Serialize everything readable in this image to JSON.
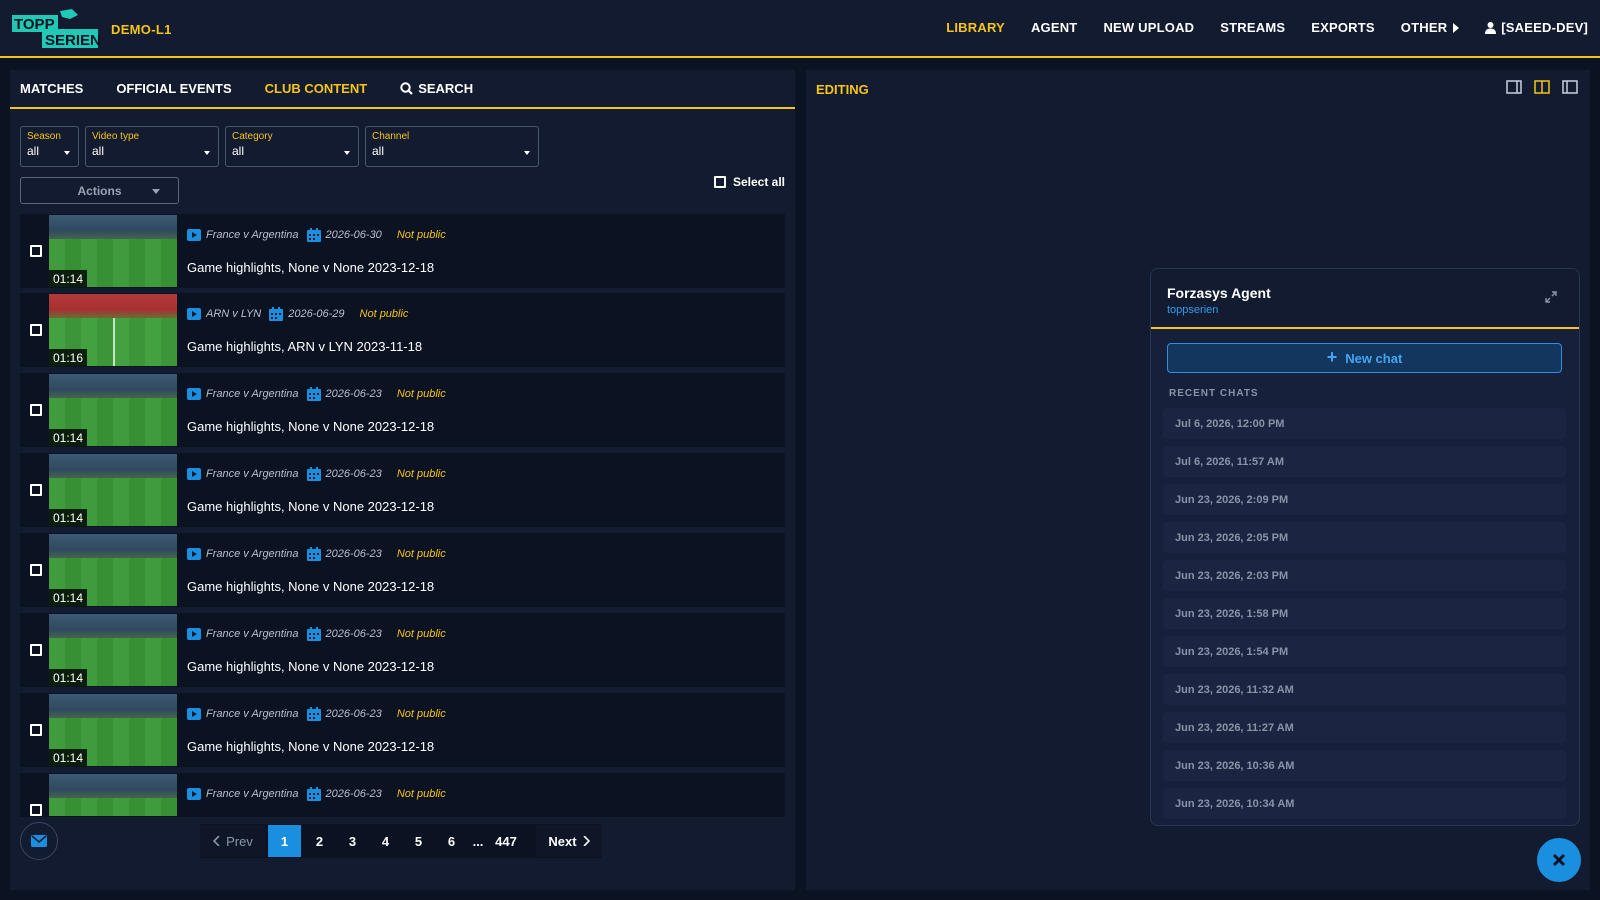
{
  "header": {
    "logo_top": "TOPP",
    "logo_bottom": "SERIEN",
    "org": "DEMO-L1",
    "nav": [
      "LIBRARY",
      "AGENT",
      "NEW UPLOAD",
      "STREAMS",
      "EXPORTS",
      "OTHER"
    ],
    "user": "[SAEED-DEV]"
  },
  "library": {
    "tabs": [
      "MATCHES",
      "OFFICIAL EVENTS",
      "CLUB CONTENT",
      "SEARCH"
    ],
    "filters": [
      {
        "label": "Season",
        "value": "all"
      },
      {
        "label": "Video type",
        "value": "all"
      },
      {
        "label": "Category",
        "value": "all"
      },
      {
        "label": "Channel",
        "value": "all"
      }
    ],
    "actions_label": "Actions",
    "select_all_label": "Select all",
    "rows": [
      {
        "duration": "01:14",
        "match": "France v Argentina",
        "date": "2026-06-30",
        "status": "Not public",
        "title": "Game highlights, None v None 2023-12-18"
      },
      {
        "duration": "01:16",
        "match": "ARN v LYN",
        "date": "2026-06-29",
        "status": "Not public",
        "title": "Game highlights, ARN v LYN 2023-11-18"
      },
      {
        "duration": "01:14",
        "match": "France v Argentina",
        "date": "2026-06-23",
        "status": "Not public",
        "title": "Game highlights, None v None 2023-12-18"
      },
      {
        "duration": "01:14",
        "match": "France v Argentina",
        "date": "2026-06-23",
        "status": "Not public",
        "title": "Game highlights, None v None 2023-12-18"
      },
      {
        "duration": "01:14",
        "match": "France v Argentina",
        "date": "2026-06-23",
        "status": "Not public",
        "title": "Game highlights, None v None 2023-12-18"
      },
      {
        "duration": "01:14",
        "match": "France v Argentina",
        "date": "2026-06-23",
        "status": "Not public",
        "title": "Game highlights, None v None 2023-12-18"
      },
      {
        "duration": "01:14",
        "match": "France v Argentina",
        "date": "2026-06-23",
        "status": "Not public",
        "title": "Game highlights, None v None 2023-12-18"
      },
      {
        "duration": "",
        "match": "France v Argentina",
        "date": "2026-06-23",
        "status": "Not public",
        "title": ""
      }
    ],
    "pagination": {
      "prev": "Prev",
      "pages": [
        "1",
        "2",
        "3",
        "4",
        "5",
        "6"
      ],
      "ellipsis": "...",
      "last": "447",
      "next": "Next",
      "current": "1"
    }
  },
  "editing": {
    "title": "EDITING"
  },
  "agent": {
    "title": "Forzasys Agent",
    "subtitle": "toppserien",
    "new_chat": "New chat",
    "recent_label": "RECENT CHATS",
    "chats": [
      "Jul 6, 2026, 12:00 PM",
      "Jul 6, 2026, 11:57 AM",
      "Jun 23, 2026, 2:09 PM",
      "Jun 23, 2026, 2:05 PM",
      "Jun 23, 2026, 2:03 PM",
      "Jun 23, 2026, 1:58 PM",
      "Jun 23, 2026, 1:54 PM",
      "Jun 23, 2026, 11:32 AM",
      "Jun 23, 2026, 11:27 AM",
      "Jun 23, 2026, 10:36 AM",
      "Jun 23, 2026, 10:34 AM"
    ]
  },
  "colors": {
    "accent": "#f5c518",
    "blue": "#1a8fe0",
    "background": "#0b1222",
    "panel": "#131b31"
  },
  "icons": [
    "logo",
    "chevron-right-icon",
    "user-icon",
    "search-icon",
    "video-icon",
    "calendar-icon",
    "mail-icon",
    "panel-left-icon",
    "panel-split-icon",
    "panel-right-icon",
    "expand-icon",
    "plus-icon",
    "close-icon"
  ]
}
